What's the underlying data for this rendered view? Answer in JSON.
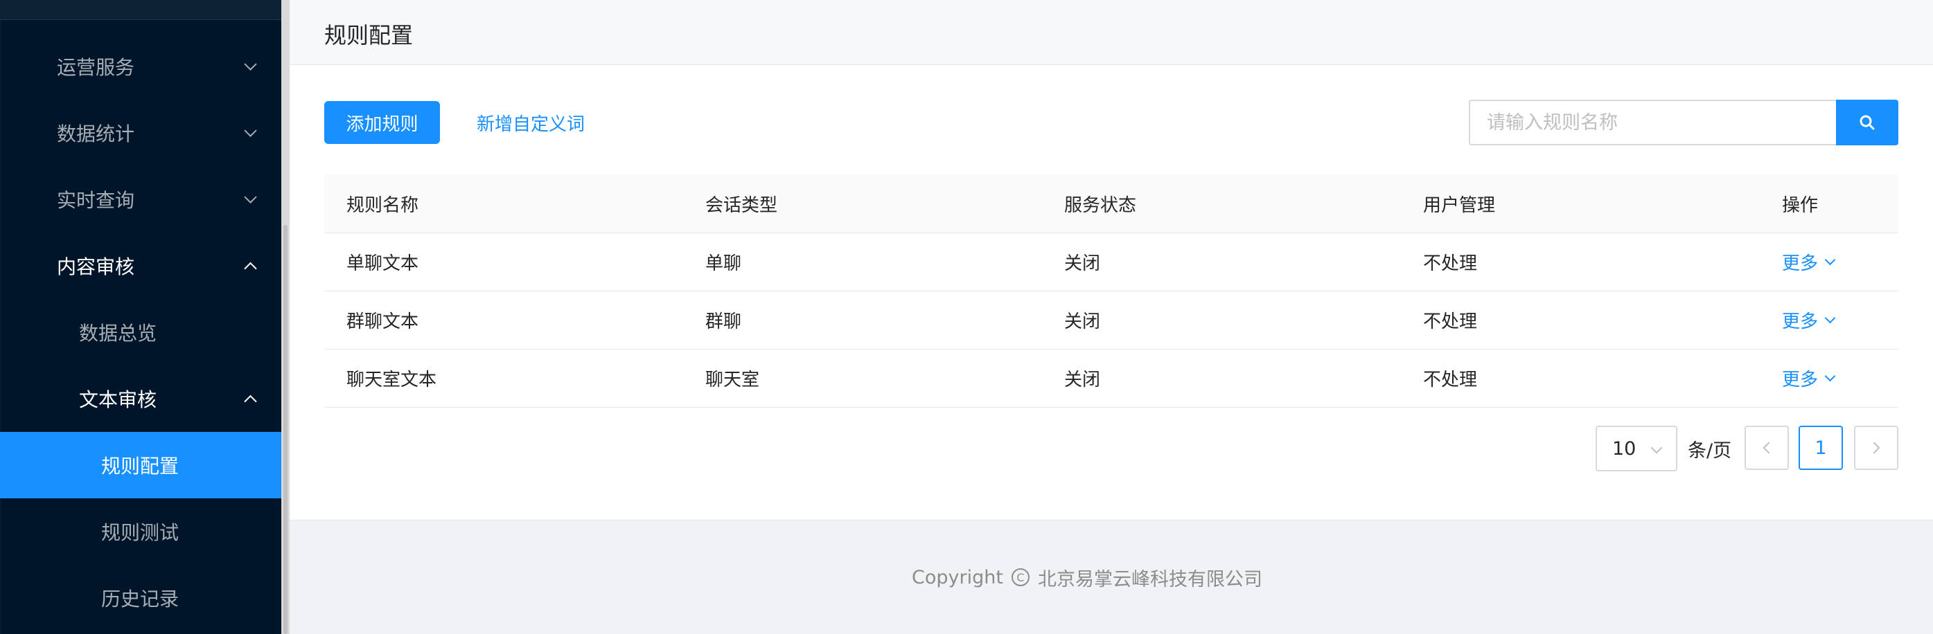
{
  "sidebar": {
    "items": [
      {
        "label": "运营服务",
        "expanded": false
      },
      {
        "label": "数据统计",
        "expanded": false
      },
      {
        "label": "实时查询",
        "expanded": false
      },
      {
        "label": "内容审核",
        "expanded": true
      },
      {
        "label": "数据总览"
      },
      {
        "label": "文本审核",
        "expanded": true
      },
      {
        "label": "规则配置",
        "selected": true
      },
      {
        "label": "规则测试"
      },
      {
        "label": "历史记录"
      }
    ]
  },
  "header": {
    "title": "规则配置"
  },
  "toolbar": {
    "add_rule_label": "添加规则",
    "add_custom_word_label": "新增自定义词",
    "search_placeholder": "请输入规则名称",
    "search_icon": "search-icon"
  },
  "table": {
    "columns": [
      "规则名称",
      "会话类型",
      "服务状态",
      "用户管理",
      "操作"
    ],
    "rows": [
      {
        "name": "单聊文本",
        "session_type": "单聊",
        "status": "关闭",
        "user_mgmt": "不处理",
        "action": "更多"
      },
      {
        "name": "群聊文本",
        "session_type": "群聊",
        "status": "关闭",
        "user_mgmt": "不处理",
        "action": "更多"
      },
      {
        "name": "聊天室文本",
        "session_type": "聊天室",
        "status": "关闭",
        "user_mgmt": "不处理",
        "action": "更多"
      }
    ]
  },
  "pagination": {
    "page_size": "10",
    "per_page_label": "条/页",
    "current_page": "1"
  },
  "footer": {
    "copyright_label": "Copyright",
    "copyright_symbol": "C",
    "company": "北京易掌云峰科技有限公司"
  },
  "colors": {
    "accent": "#1890ff",
    "sidebar_bg": "#001529"
  }
}
